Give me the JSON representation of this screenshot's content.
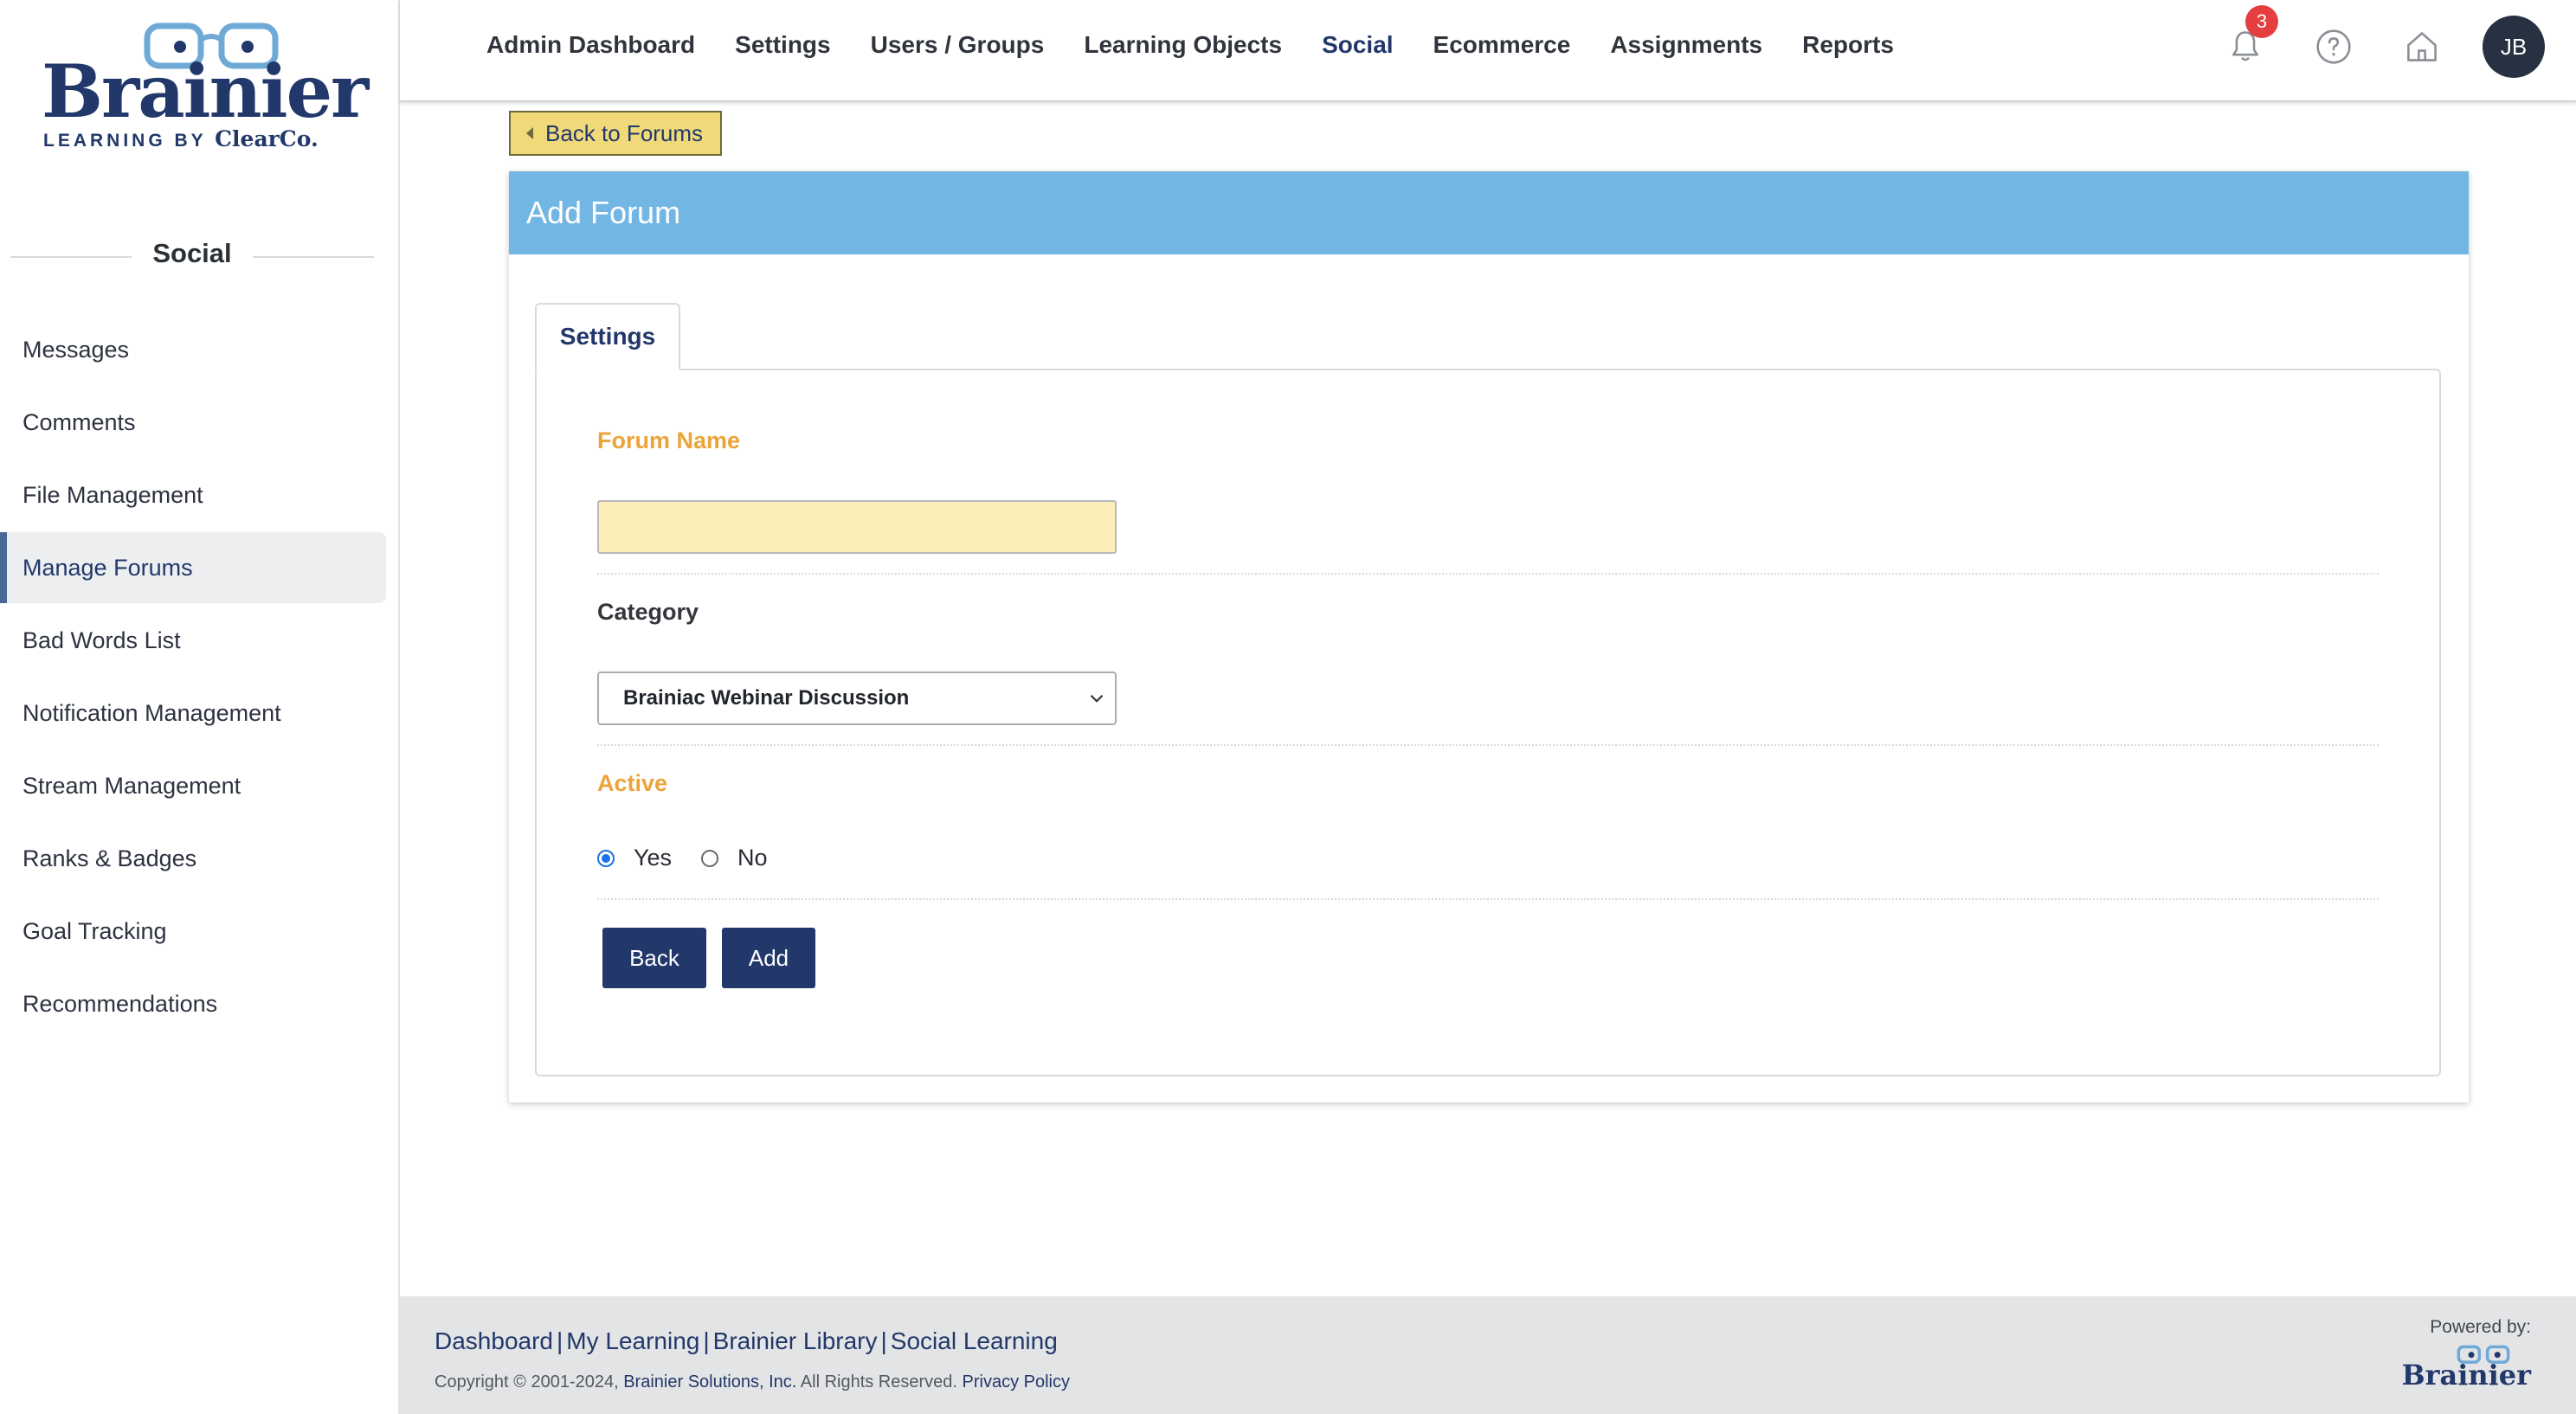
{
  "brand": {
    "name": "Brainier",
    "tagline_prefix": "LEARNING BY",
    "tagline_company": "ClearCo."
  },
  "sidebar": {
    "section_title": "Social",
    "items": [
      {
        "label": "Messages"
      },
      {
        "label": "Comments"
      },
      {
        "label": "File Management"
      },
      {
        "label": "Manage Forums"
      },
      {
        "label": "Bad Words List"
      },
      {
        "label": "Notification Management"
      },
      {
        "label": "Stream Management"
      },
      {
        "label": "Ranks & Badges"
      },
      {
        "label": "Goal Tracking"
      },
      {
        "label": "Recommendations"
      }
    ],
    "active_item": "Manage Forums"
  },
  "topnav": {
    "items": [
      {
        "label": "Admin Dashboard"
      },
      {
        "label": "Settings"
      },
      {
        "label": "Users / Groups"
      },
      {
        "label": "Learning Objects"
      },
      {
        "label": "Social"
      },
      {
        "label": "Ecommerce"
      },
      {
        "label": "Assignments"
      },
      {
        "label": "Reports"
      }
    ],
    "active_item": "Social",
    "notification_count": "3",
    "icons": [
      "bell-icon",
      "help-icon",
      "home-icon"
    ],
    "avatar_initials": "JB"
  },
  "main": {
    "back_button": "Back to Forums",
    "panel_title": "Add Forum",
    "tab": "Settings",
    "forum_name_label": "Forum Name",
    "forum_name_value": "",
    "category_label": "Category",
    "category_selected": "Brainiac Webinar Discussion",
    "active_label": "Active",
    "active_options": [
      {
        "label": "Yes",
        "checked": true
      },
      {
        "label": "No",
        "checked": false
      }
    ],
    "buttons": {
      "back": "Back",
      "add": "Add"
    }
  },
  "footer": {
    "links": [
      "Dashboard",
      "My Learning",
      "Brainier Library",
      "Social Learning"
    ],
    "copyright_prefix": "Copyright © 2001-2024,",
    "copyright_company": "Brainier Solutions, Inc.",
    "copyright_suffix": "All Rights Reserved.",
    "privacy": "Privacy Policy",
    "powered_by": "Powered by:",
    "powered_brand": "Brainier"
  },
  "colors": {
    "brand_navy": "#22386a",
    "panel_header": "#72b6e4",
    "label_orange": "#eca43a",
    "input_yellow": "#fbeeb8",
    "badge_red": "#e53e3e"
  }
}
